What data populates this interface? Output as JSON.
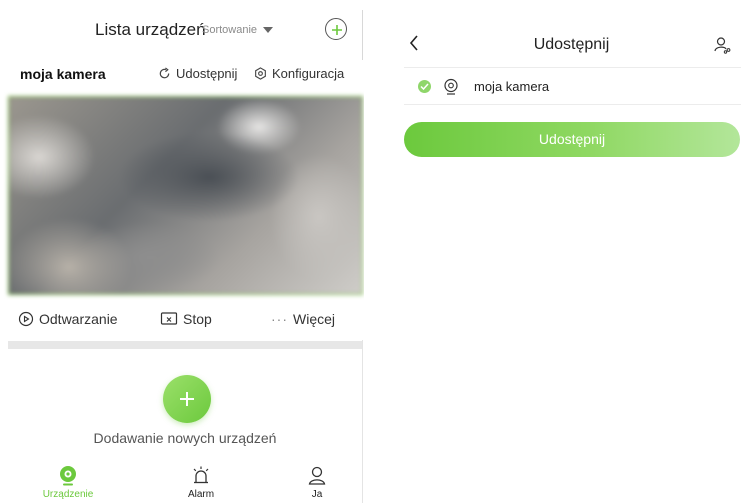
{
  "device_list": {
    "title": "Lista urządzeń",
    "sort_label": "Sortowanie",
    "camera": {
      "name": "moja kamera",
      "share_label": "Udostępnij",
      "config_label": "Konfiguracja"
    },
    "controls": {
      "playback_label": "Odtwarzanie",
      "stop_label": "Stop",
      "more_label": "Więcej",
      "more_dots": "···"
    },
    "add_device_label": "Dodawanie nowych urządzeń",
    "tabs": [
      {
        "label": "Urządzenie",
        "icon": "camera-icon",
        "active": true
      },
      {
        "label": "Alarm",
        "icon": "alarm-icon",
        "active": false
      },
      {
        "label": "Ja",
        "icon": "person-icon",
        "active": false
      }
    ]
  },
  "share_panel": {
    "title": "Udostępnij",
    "device_name": "moja kamera",
    "share_button_label": "Udostępnij"
  },
  "colors": {
    "accent": "#6cc93d",
    "accent_light": "#b3e69a",
    "video_border": "#7cc444"
  }
}
